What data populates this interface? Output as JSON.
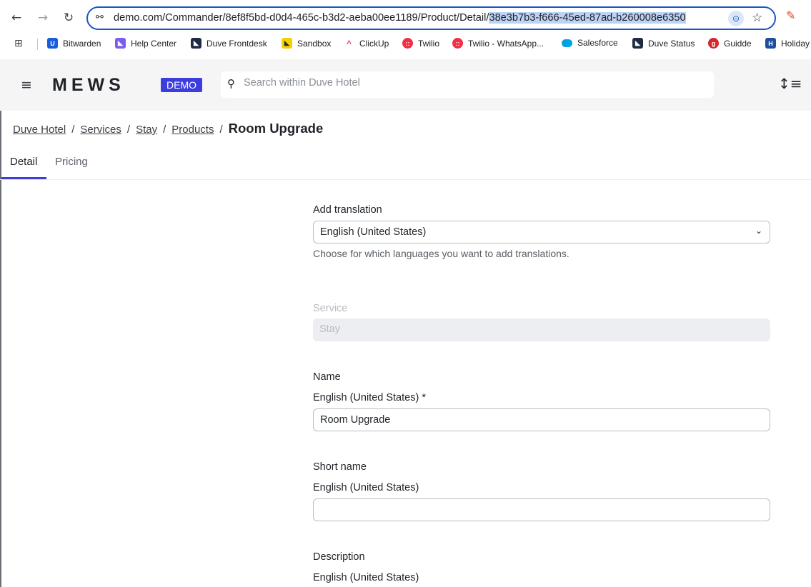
{
  "browser": {
    "url_prefix": "demo.com/Commander/8ef8f5bd-d0d4-465c-b3d2-aeba00ee1189/Product/Detail/",
    "url_selected": "38e3b7b3-f666-45ed-87ad-b260008e6350",
    "bookmarks": [
      {
        "label": "Bitwarden",
        "icon": "bitwarden-icon",
        "color": "#175ddc"
      },
      {
        "label": "Help Center",
        "icon": "duve-icon",
        "color": "#7b5cf0"
      },
      {
        "label": "Duve Frontdesk",
        "icon": "duve-icon",
        "color": "#1f2a44"
      },
      {
        "label": "Sandbox",
        "icon": "duve-icon",
        "color": "#f5d000"
      },
      {
        "label": "ClickUp",
        "icon": "clickup-icon",
        "color": "#e9407a"
      },
      {
        "label": "Twilio",
        "icon": "twilio-icon",
        "color": "#f22f46"
      },
      {
        "label": "Twilio - WhatsApp...",
        "icon": "twilio-icon",
        "color": "#f22f46"
      },
      {
        "label": "Salesforce",
        "icon": "salesforce-icon",
        "color": "#00a1e0"
      },
      {
        "label": "Duve Status",
        "icon": "duve-icon",
        "color": "#1f2a44"
      },
      {
        "label": "Guidde",
        "icon": "guidde-icon",
        "color": "#d9262a"
      },
      {
        "label": "Holiday",
        "icon": "holiday-icon",
        "color": "#1d4f9e"
      }
    ]
  },
  "header": {
    "logo": "MEWS",
    "badge": "DEMO",
    "search_placeholder": "Search within Duve Hotel"
  },
  "breadcrumb": {
    "items": [
      "Duve Hotel",
      "Services",
      "Stay",
      "Products"
    ],
    "separator": "/",
    "current": "Room Upgrade"
  },
  "tabs": {
    "detail": "Detail",
    "pricing": "Pricing"
  },
  "form": {
    "add_translation": {
      "label": "Add translation",
      "value": "English (United States)",
      "helper": "Choose for which languages you want to add translations."
    },
    "service": {
      "label": "Service",
      "value": "Stay"
    },
    "name": {
      "label": "Name",
      "sublabel": "English (United States) *",
      "value": "Room Upgrade"
    },
    "short_name": {
      "label": "Short name",
      "sublabel": "English (United States)",
      "value": ""
    },
    "description": {
      "label": "Description",
      "sublabel": "English (United States)"
    }
  },
  "colors": {
    "accent": "#3d3dde",
    "omnibox_border": "#1a56c8"
  }
}
